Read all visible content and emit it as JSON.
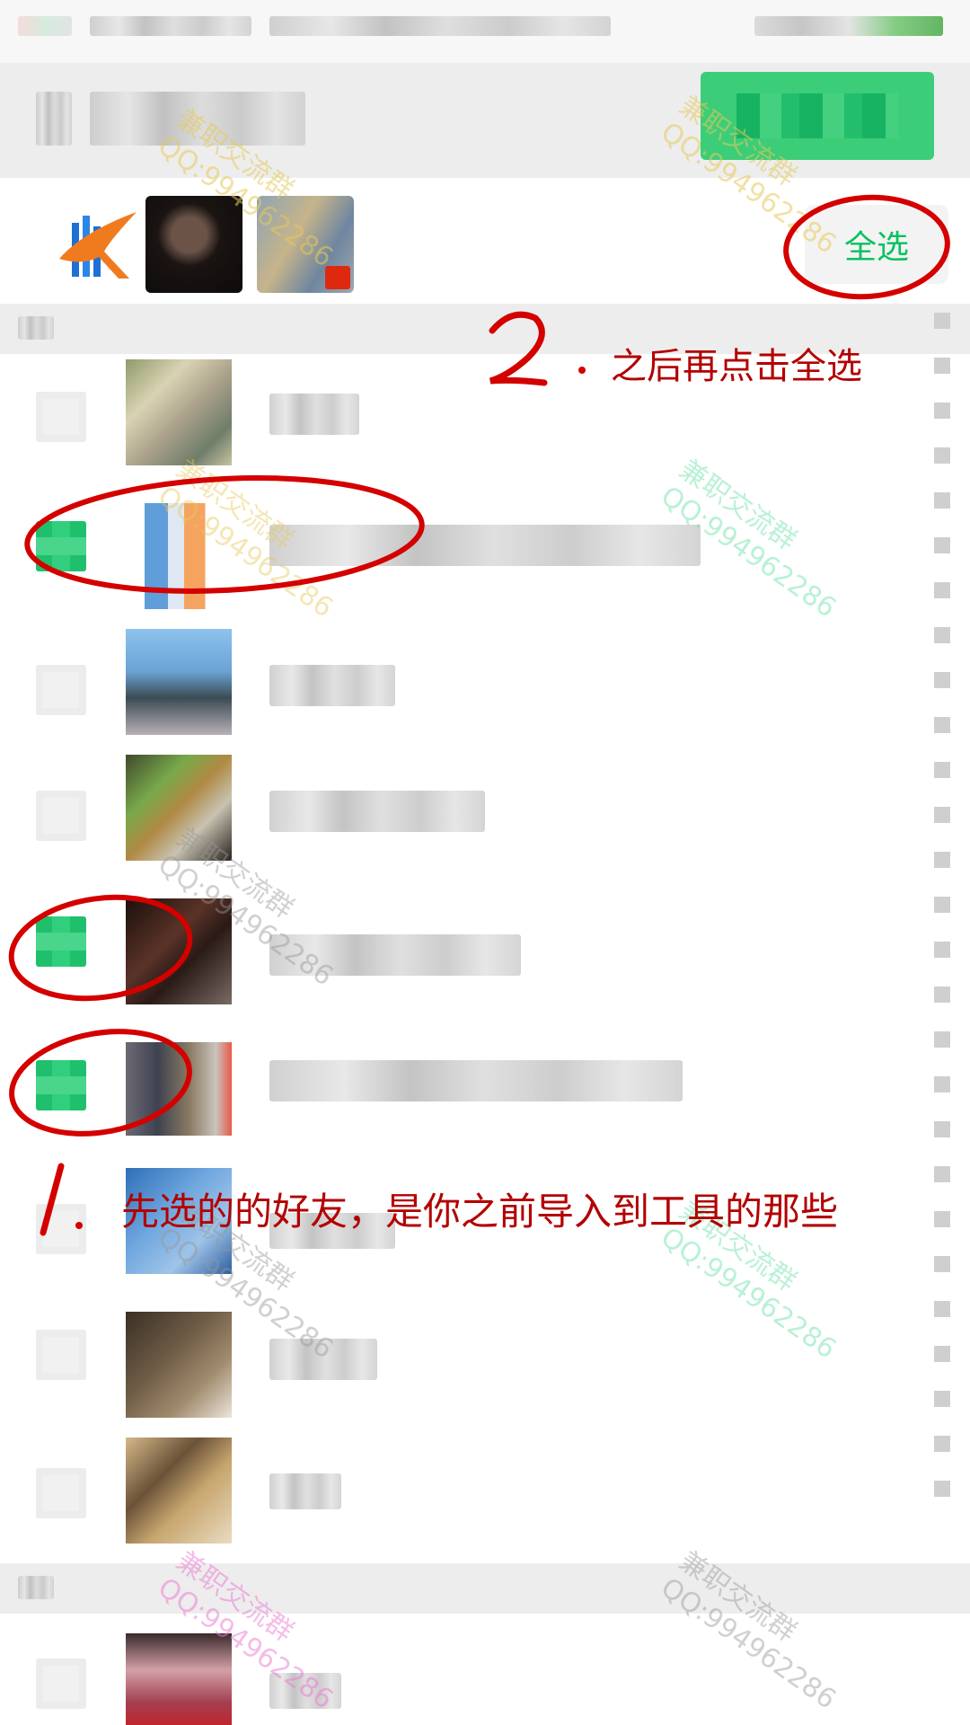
{
  "header": {
    "select_all_label": "全选"
  },
  "annotations": {
    "step2_text": "之后再点击全选",
    "step1_text": "先选的的好友，是你之前导入到工具的那些"
  },
  "watermark": {
    "line1": "兼职交流群",
    "line2": "QQ:994962286"
  },
  "contacts": [
    {
      "checked": false
    },
    {
      "checked": true
    },
    {
      "checked": false
    },
    {
      "checked": false
    },
    {
      "checked": true
    },
    {
      "checked": true
    },
    {
      "checked": false
    },
    {
      "checked": false
    },
    {
      "checked": false
    },
    {
      "checked": false
    }
  ],
  "colors": {
    "accent_green": "#07c160",
    "annotation_red": "#d40000",
    "header_bg": "#ededed"
  }
}
